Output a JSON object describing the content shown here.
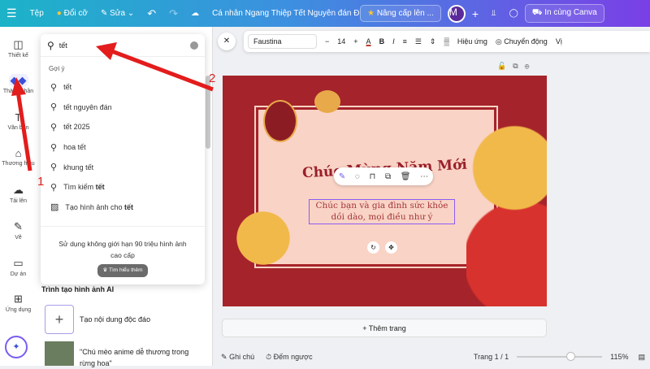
{
  "topbar": {
    "menu_icon": "hamburger-icon",
    "file": "Tệp",
    "resize": "Đổi cỡ",
    "edit": "Sửa",
    "doc_title": "Cá nhân Ngang Thiệp Tết Nguyên đán Đỏ ...",
    "upgrade": "Nâng cấp lên ...",
    "avatar": "M",
    "print": "In cùng Canva"
  },
  "rail": [
    {
      "label": "Thiết kế",
      "icon": "layout-icon"
    },
    {
      "label": "Thành phần",
      "icon": "elements-icon",
      "active": true
    },
    {
      "label": "Văn bản",
      "icon": "text-icon"
    },
    {
      "label": "Thương hiệu",
      "icon": "brand-icon"
    },
    {
      "label": "Tải lên",
      "icon": "upload-icon"
    },
    {
      "label": "Vẽ",
      "icon": "draw-icon"
    },
    {
      "label": "Dự án",
      "icon": "folder-icon"
    },
    {
      "label": "Ứng dụng",
      "icon": "apps-icon"
    }
  ],
  "search": {
    "value": "tết",
    "suggestions_heading": "Gợi ý",
    "suggestions": [
      "tết",
      "tết nguyên đán",
      "tết 2025",
      "hoa tết",
      "khung tết"
    ],
    "search_prefix": "Tìm kiếm",
    "search_term": "tết",
    "generate_prefix": "Tạo hình ảnh cho",
    "generate_term": "tết",
    "promo_text": "Sử dụng không giới hạn 90 triệu hình ảnh cao cấp",
    "promo_button": "Tìm hiểu thêm"
  },
  "ai": {
    "heading": "Trình tạo hình ảnh AI",
    "create": "Tạo nội dung độc đáo",
    "example": "\"Chú mèo anime dễ thương trong rừng hoa\""
  },
  "toolbar": {
    "font": "Faustina",
    "font_size": "14",
    "effects": "Hiệu ứng",
    "animate": "Chuyển động",
    "position": "Vị"
  },
  "design": {
    "title": "Chúc Mừng Năm Mới",
    "body": "Chúc bạn và gia đình sức khỏe dồi dào, mọi điều như ý",
    "bg_color": "#a5232a"
  },
  "add_page": "+ Thêm trang",
  "footer": {
    "notes": "Ghi chú",
    "timer": "Đếm ngược",
    "page": "Trang 1 / 1",
    "zoom": "115%",
    "zoom_value": 115
  },
  "annotations": {
    "step1": "1",
    "step2": "2"
  }
}
